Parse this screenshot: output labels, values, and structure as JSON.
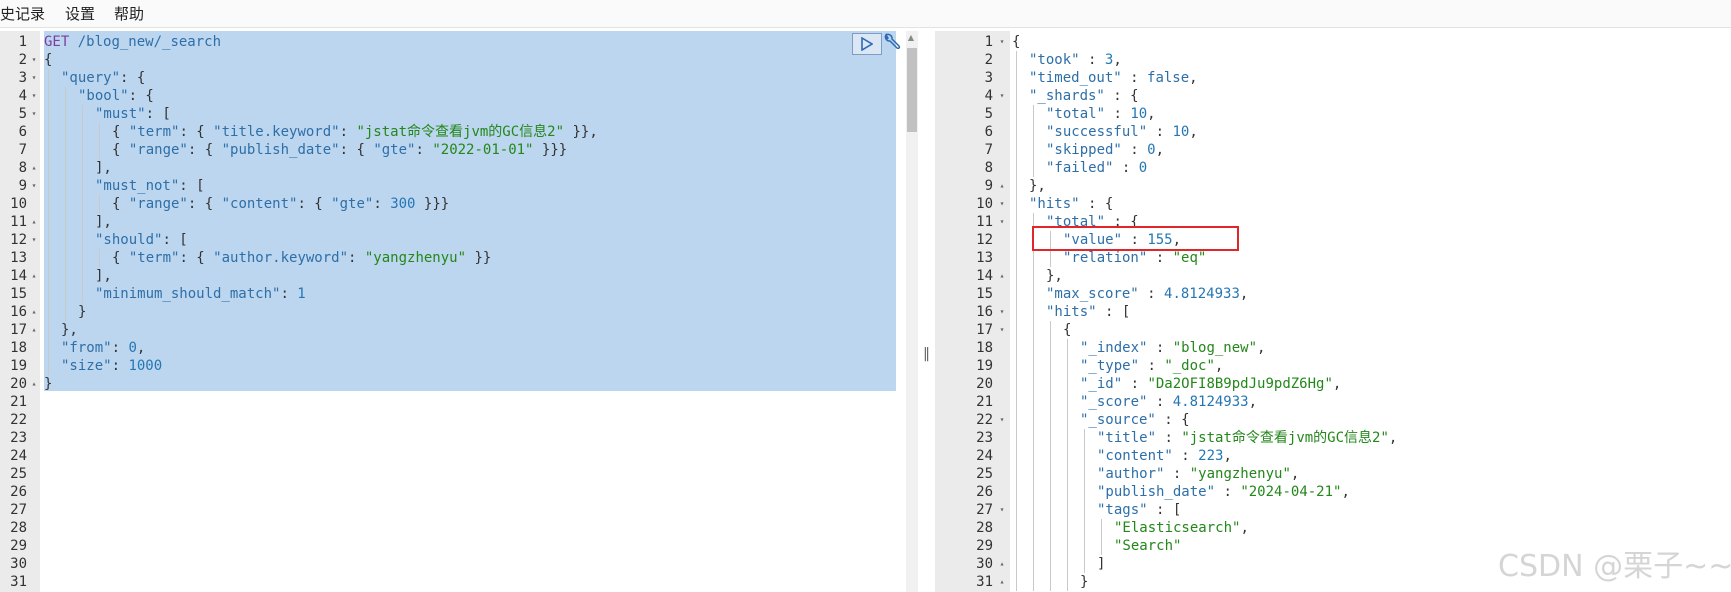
{
  "menu": [
    "史记录",
    "设置",
    "帮助"
  ],
  "request": {
    "lines": [
      {
        "n": 1,
        "fold": "",
        "indent": 0,
        "tokens": [
          [
            "m",
            "GET"
          ],
          [
            "p",
            " "
          ],
          [
            "k",
            "/blog_new/_search"
          ]
        ]
      },
      {
        "n": 2,
        "fold": "▾",
        "indent": 0,
        "tokens": [
          [
            "p",
            "{"
          ]
        ]
      },
      {
        "n": 3,
        "fold": "▾",
        "indent": 1,
        "tokens": [
          [
            "k",
            "\"query\""
          ],
          [
            "p",
            ": {"
          ]
        ]
      },
      {
        "n": 4,
        "fold": "▾",
        "indent": 2,
        "tokens": [
          [
            "k",
            "\"bool\""
          ],
          [
            "p",
            ": {"
          ]
        ]
      },
      {
        "n": 5,
        "fold": "▾",
        "indent": 3,
        "tokens": [
          [
            "k",
            "\"must\""
          ],
          [
            "p",
            ": ["
          ]
        ]
      },
      {
        "n": 6,
        "fold": "",
        "indent": 4,
        "tokens": [
          [
            "p",
            "{ "
          ],
          [
            "k",
            "\"term\""
          ],
          [
            "p",
            ": { "
          ],
          [
            "k",
            "\"title.keyword\""
          ],
          [
            "p",
            ": "
          ],
          [
            "s",
            "\"jstat命令查看jvm的GC信息2\""
          ],
          [
            "p",
            " }},"
          ]
        ]
      },
      {
        "n": 7,
        "fold": "",
        "indent": 4,
        "tokens": [
          [
            "p",
            "{ "
          ],
          [
            "k",
            "\"range\""
          ],
          [
            "p",
            ": { "
          ],
          [
            "k",
            "\"publish_date\""
          ],
          [
            "p",
            ": { "
          ],
          [
            "k",
            "\"gte\""
          ],
          [
            "p",
            ": "
          ],
          [
            "s",
            "\"2022-01-01\""
          ],
          [
            "p",
            " }}}"
          ]
        ]
      },
      {
        "n": 8,
        "fold": "▴",
        "indent": 3,
        "tokens": [
          [
            "p",
            "],"
          ]
        ]
      },
      {
        "n": 9,
        "fold": "▾",
        "indent": 3,
        "tokens": [
          [
            "k",
            "\"must_not\""
          ],
          [
            "p",
            ": ["
          ]
        ]
      },
      {
        "n": 10,
        "fold": "",
        "indent": 4,
        "tokens": [
          [
            "p",
            "{ "
          ],
          [
            "k",
            "\"range\""
          ],
          [
            "p",
            ": { "
          ],
          [
            "k",
            "\"content\""
          ],
          [
            "p",
            ": { "
          ],
          [
            "k",
            "\"gte\""
          ],
          [
            "p",
            ": "
          ],
          [
            "n",
            "300"
          ],
          [
            "p",
            " }}}"
          ]
        ]
      },
      {
        "n": 11,
        "fold": "▴",
        "indent": 3,
        "tokens": [
          [
            "p",
            "],"
          ]
        ]
      },
      {
        "n": 12,
        "fold": "▾",
        "indent": 3,
        "tokens": [
          [
            "k",
            "\"should\""
          ],
          [
            "p",
            ": ["
          ]
        ]
      },
      {
        "n": 13,
        "fold": "",
        "indent": 4,
        "tokens": [
          [
            "p",
            "{ "
          ],
          [
            "k",
            "\"term\""
          ],
          [
            "p",
            ": { "
          ],
          [
            "k",
            "\"author.keyword\""
          ],
          [
            "p",
            ": "
          ],
          [
            "s",
            "\"yangzhenyu\""
          ],
          [
            "p",
            " }}"
          ]
        ]
      },
      {
        "n": 14,
        "fold": "▴",
        "indent": 3,
        "tokens": [
          [
            "p",
            "],"
          ]
        ]
      },
      {
        "n": 15,
        "fold": "",
        "indent": 3,
        "tokens": [
          [
            "k",
            "\"minimum_should_match\""
          ],
          [
            "p",
            ": "
          ],
          [
            "n",
            "1"
          ]
        ]
      },
      {
        "n": 16,
        "fold": "▴",
        "indent": 2,
        "tokens": [
          [
            "p",
            "}"
          ]
        ]
      },
      {
        "n": 17,
        "fold": "▴",
        "indent": 1,
        "tokens": [
          [
            "p",
            "},"
          ]
        ]
      },
      {
        "n": 18,
        "fold": "",
        "indent": 1,
        "tokens": [
          [
            "k",
            "\"from\""
          ],
          [
            "p",
            ": "
          ],
          [
            "n",
            "0"
          ],
          [
            "p",
            ","
          ]
        ]
      },
      {
        "n": 19,
        "fold": "",
        "indent": 1,
        "tokens": [
          [
            "k",
            "\"size\""
          ],
          [
            "p",
            ": "
          ],
          [
            "n",
            "1000"
          ]
        ]
      },
      {
        "n": 20,
        "fold": "▴",
        "indent": 0,
        "tokens": [
          [
            "p",
            "}"
          ]
        ]
      },
      {
        "n": 21,
        "fold": "",
        "indent": 0,
        "tokens": []
      },
      {
        "n": 22,
        "fold": "",
        "indent": 0,
        "tokens": []
      },
      {
        "n": 23,
        "fold": "",
        "indent": 0,
        "tokens": []
      },
      {
        "n": 24,
        "fold": "",
        "indent": 0,
        "tokens": []
      },
      {
        "n": 25,
        "fold": "",
        "indent": 0,
        "tokens": []
      },
      {
        "n": 26,
        "fold": "",
        "indent": 0,
        "tokens": []
      },
      {
        "n": 27,
        "fold": "",
        "indent": 0,
        "tokens": []
      },
      {
        "n": 28,
        "fold": "",
        "indent": 0,
        "tokens": []
      },
      {
        "n": 29,
        "fold": "",
        "indent": 0,
        "tokens": []
      },
      {
        "n": 30,
        "fold": "",
        "indent": 0,
        "tokens": []
      },
      {
        "n": 31,
        "fold": "",
        "indent": 0,
        "tokens": []
      }
    ]
  },
  "response": {
    "lines": [
      {
        "n": 1,
        "fold": "▾",
        "indent": 0,
        "tokens": [
          [
            "p",
            "{"
          ]
        ]
      },
      {
        "n": 2,
        "fold": "",
        "indent": 1,
        "tokens": [
          [
            "k",
            "\"took\""
          ],
          [
            "p",
            " : "
          ],
          [
            "n",
            "3"
          ],
          [
            "p",
            ","
          ]
        ]
      },
      {
        "n": 3,
        "fold": "",
        "indent": 1,
        "tokens": [
          [
            "k",
            "\"timed_out\""
          ],
          [
            "p",
            " : "
          ],
          [
            "b",
            "false"
          ],
          [
            "p",
            ","
          ]
        ]
      },
      {
        "n": 4,
        "fold": "▾",
        "indent": 1,
        "tokens": [
          [
            "k",
            "\"_shards\""
          ],
          [
            "p",
            " : {"
          ]
        ]
      },
      {
        "n": 5,
        "fold": "",
        "indent": 2,
        "tokens": [
          [
            "k",
            "\"total\""
          ],
          [
            "p",
            " : "
          ],
          [
            "n",
            "10"
          ],
          [
            "p",
            ","
          ]
        ]
      },
      {
        "n": 6,
        "fold": "",
        "indent": 2,
        "tokens": [
          [
            "k",
            "\"successful\""
          ],
          [
            "p",
            " : "
          ],
          [
            "n",
            "10"
          ],
          [
            "p",
            ","
          ]
        ]
      },
      {
        "n": 7,
        "fold": "",
        "indent": 2,
        "tokens": [
          [
            "k",
            "\"skipped\""
          ],
          [
            "p",
            " : "
          ],
          [
            "n",
            "0"
          ],
          [
            "p",
            ","
          ]
        ]
      },
      {
        "n": 8,
        "fold": "",
        "indent": 2,
        "tokens": [
          [
            "k",
            "\"failed\""
          ],
          [
            "p",
            " : "
          ],
          [
            "n",
            "0"
          ]
        ]
      },
      {
        "n": 9,
        "fold": "▴",
        "indent": 1,
        "tokens": [
          [
            "p",
            "},"
          ]
        ]
      },
      {
        "n": 10,
        "fold": "▾",
        "indent": 1,
        "tokens": [
          [
            "k",
            "\"hits\""
          ],
          [
            "p",
            " : {"
          ]
        ]
      },
      {
        "n": 11,
        "fold": "▾",
        "indent": 2,
        "tokens": [
          [
            "k",
            "\"total\""
          ],
          [
            "p",
            " : {"
          ]
        ]
      },
      {
        "n": 12,
        "fold": "",
        "indent": 3,
        "tokens": [
          [
            "k",
            "\"value\""
          ],
          [
            "p",
            " : "
          ],
          [
            "n",
            "155"
          ],
          [
            "p",
            ","
          ]
        ]
      },
      {
        "n": 13,
        "fold": "",
        "indent": 3,
        "tokens": [
          [
            "k",
            "\"relation\""
          ],
          [
            "p",
            " : "
          ],
          [
            "s",
            "\"eq\""
          ]
        ]
      },
      {
        "n": 14,
        "fold": "▴",
        "indent": 2,
        "tokens": [
          [
            "p",
            "},"
          ]
        ]
      },
      {
        "n": 15,
        "fold": "",
        "indent": 2,
        "tokens": [
          [
            "k",
            "\"max_score\""
          ],
          [
            "p",
            " : "
          ],
          [
            "n",
            "4.8124933"
          ],
          [
            "p",
            ","
          ]
        ]
      },
      {
        "n": 16,
        "fold": "▾",
        "indent": 2,
        "tokens": [
          [
            "k",
            "\"hits\""
          ],
          [
            "p",
            " : ["
          ]
        ]
      },
      {
        "n": 17,
        "fold": "▾",
        "indent": 3,
        "tokens": [
          [
            "p",
            "{"
          ]
        ]
      },
      {
        "n": 18,
        "fold": "",
        "indent": 4,
        "tokens": [
          [
            "k",
            "\"_index\""
          ],
          [
            "p",
            " : "
          ],
          [
            "s",
            "\"blog_new\""
          ],
          [
            "p",
            ","
          ]
        ]
      },
      {
        "n": 19,
        "fold": "",
        "indent": 4,
        "tokens": [
          [
            "k",
            "\"_type\""
          ],
          [
            "p",
            " : "
          ],
          [
            "s",
            "\"_doc\""
          ],
          [
            "p",
            ","
          ]
        ]
      },
      {
        "n": 20,
        "fold": "",
        "indent": 4,
        "tokens": [
          [
            "k",
            "\"_id\""
          ],
          [
            "p",
            " : "
          ],
          [
            "s",
            "\"Da2OFI8B9pdJu9pdZ6Hg\""
          ],
          [
            "p",
            ","
          ]
        ]
      },
      {
        "n": 21,
        "fold": "",
        "indent": 4,
        "tokens": [
          [
            "k",
            "\"_score\""
          ],
          [
            "p",
            " : "
          ],
          [
            "n",
            "4.8124933"
          ],
          [
            "p",
            ","
          ]
        ]
      },
      {
        "n": 22,
        "fold": "▾",
        "indent": 4,
        "tokens": [
          [
            "k",
            "\"_source\""
          ],
          [
            "p",
            " : {"
          ]
        ]
      },
      {
        "n": 23,
        "fold": "",
        "indent": 5,
        "tokens": [
          [
            "k",
            "\"title\""
          ],
          [
            "p",
            " : "
          ],
          [
            "s",
            "\"jstat命令查看jvm的GC信息2\""
          ],
          [
            "p",
            ","
          ]
        ]
      },
      {
        "n": 24,
        "fold": "",
        "indent": 5,
        "tokens": [
          [
            "k",
            "\"content\""
          ],
          [
            "p",
            " : "
          ],
          [
            "n",
            "223"
          ],
          [
            "p",
            ","
          ]
        ]
      },
      {
        "n": 25,
        "fold": "",
        "indent": 5,
        "tokens": [
          [
            "k",
            "\"author\""
          ],
          [
            "p",
            " : "
          ],
          [
            "s",
            "\"yangzhenyu\""
          ],
          [
            "p",
            ","
          ]
        ]
      },
      {
        "n": 26,
        "fold": "",
        "indent": 5,
        "tokens": [
          [
            "k",
            "\"publish_date\""
          ],
          [
            "p",
            " : "
          ],
          [
            "s",
            "\"2024-04-21\""
          ],
          [
            "p",
            ","
          ]
        ]
      },
      {
        "n": 27,
        "fold": "▾",
        "indent": 5,
        "tokens": [
          [
            "k",
            "\"tags\""
          ],
          [
            "p",
            " : ["
          ]
        ]
      },
      {
        "n": 28,
        "fold": "",
        "indent": 6,
        "tokens": [
          [
            "s",
            "\"Elasticsearch\""
          ],
          [
            "p",
            ","
          ]
        ]
      },
      {
        "n": 29,
        "fold": "",
        "indent": 6,
        "tokens": [
          [
            "s",
            "\"Search\""
          ]
        ]
      },
      {
        "n": 30,
        "fold": "▴",
        "indent": 5,
        "tokens": [
          [
            "p",
            "]"
          ]
        ]
      },
      {
        "n": 31,
        "fold": "▴",
        "indent": 4,
        "tokens": [
          [
            "p",
            "}"
          ]
        ]
      }
    ]
  },
  "watermark": "CSDN @栗子~~",
  "colors": {
    "selection": "#bcd6ef",
    "highlight_box": "#e0262b",
    "string": "#23871a",
    "key": "#2e6fa8"
  },
  "icons": {
    "run": "play-icon",
    "settings": "wrench-icon"
  }
}
